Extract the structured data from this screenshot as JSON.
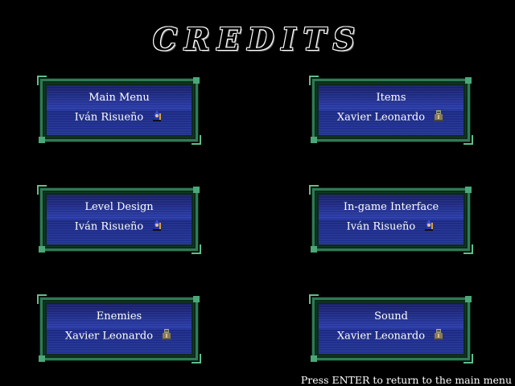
{
  "title": "CREDITS",
  "credits": [
    {
      "role": "Main Menu",
      "person": "Iván Risueño",
      "icon": "wizard-icon"
    },
    {
      "role": "Items",
      "person": "Xavier Leonardo",
      "icon": "knight-icon"
    },
    {
      "role": "Level Design",
      "person": "Iván Risueño",
      "icon": "wizard-icon"
    },
    {
      "role": "In-game Interface",
      "person": "Iván Risueño",
      "icon": "wizard-icon"
    },
    {
      "role": "Enemies",
      "person": "Xavier Leonardo",
      "icon": "knight-icon"
    },
    {
      "role": "Sound",
      "person": "Xavier Leonardo",
      "icon": "knight-icon"
    }
  ],
  "footer": "Press ENTER to return to the main menu",
  "colors": {
    "background": "#000000",
    "panel": "#2a3ca8",
    "frame": "#2f7a55",
    "text": "#ffffff"
  }
}
